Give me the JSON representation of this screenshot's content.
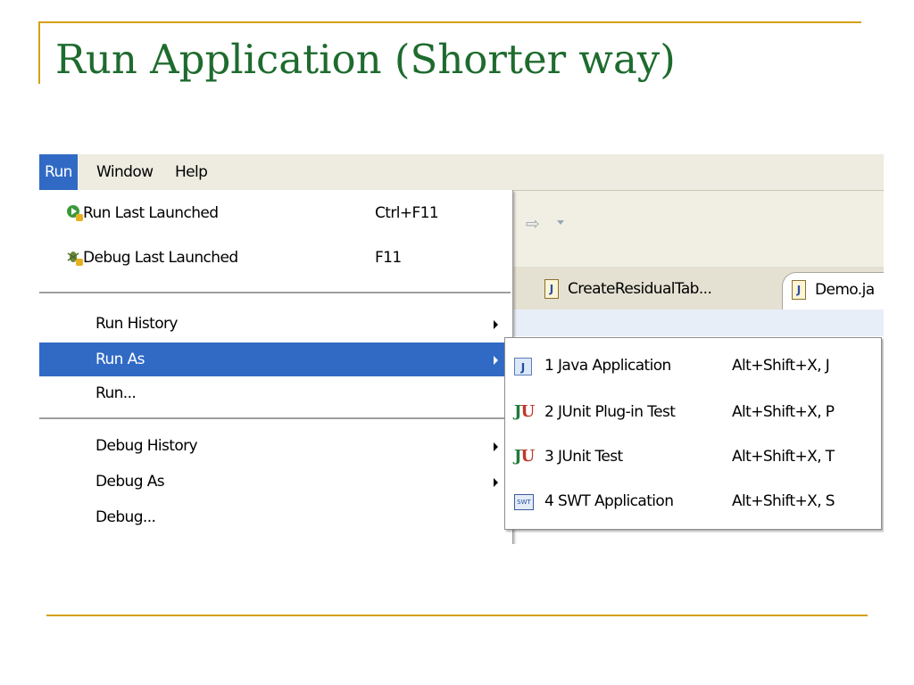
{
  "slide": {
    "title": "Run Application (Shorter way)"
  },
  "menubar": {
    "items": [
      "Run",
      "Window",
      "Help"
    ]
  },
  "toolbar": {
    "forward_icon": "forward-arrow-icon"
  },
  "tabs": [
    {
      "label": "CreateResidualTab...",
      "icon": "java-file-icon"
    },
    {
      "label": "Demo.ja",
      "icon": "java-file-icon"
    }
  ],
  "run_menu": {
    "run_last": {
      "label": "Run Last Launched",
      "accel": "Ctrl+F11",
      "icon": "run-icon"
    },
    "debug_last": {
      "label": "Debug Last Launched",
      "accel": "F11",
      "icon": "debug-icon"
    },
    "run_history": {
      "label": "Run History"
    },
    "run_as": {
      "label": "Run As"
    },
    "run": {
      "label": "Run..."
    },
    "debug_history": {
      "label": "Debug History"
    },
    "debug_as": {
      "label": "Debug As"
    },
    "debug": {
      "label": "Debug..."
    }
  },
  "run_as_submenu": [
    {
      "label": "1 Java Application",
      "accel": "Alt+Shift+X, J",
      "icon": "java-app-icon"
    },
    {
      "label": "2 JUnit Plug-in Test",
      "accel": "Alt+Shift+X, P",
      "icon": "junit-plugin-icon"
    },
    {
      "label": "3 JUnit Test",
      "accel": "Alt+Shift+X, T",
      "icon": "junit-icon"
    },
    {
      "label": "4 SWT Application",
      "accel": "Alt+Shift+X, S",
      "icon": "swt-icon"
    }
  ],
  "colors": {
    "title": "#1E6B2E",
    "rule": "#D4A017",
    "highlight": "#316AC5"
  }
}
